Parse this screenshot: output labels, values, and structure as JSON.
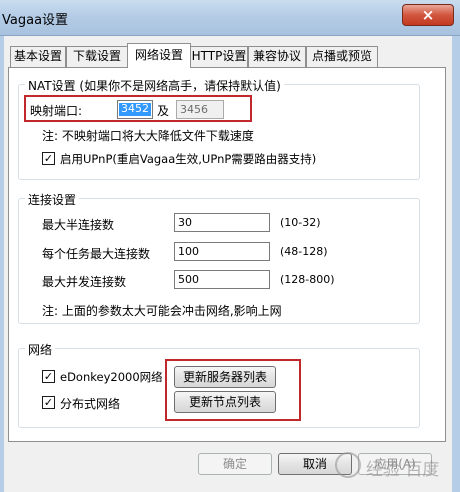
{
  "window": {
    "title": "Vagaa设置",
    "close_glyph": "×"
  },
  "tabs": [
    {
      "label": "基本设置",
      "active": false
    },
    {
      "label": "下载设置",
      "active": false
    },
    {
      "label": "网络设置",
      "active": true
    },
    {
      "label": "HTTP设置",
      "active": false
    },
    {
      "label": "兼容协议",
      "active": false
    },
    {
      "label": "点播或预览",
      "active": false
    }
  ],
  "nat": {
    "legend": "NAT设置 (如果你不是网络高手，请保持默认值)",
    "port_label": "映射端口:",
    "port_value": "3452",
    "and_label": "及",
    "port2_value": "3456",
    "note": "注: 不映射端口将大大降低文件下载速度",
    "upnp_label": "启用UPnP(重启Vagaa生效,UPnP需要路由器支持)",
    "upnp_checked": true
  },
  "connection": {
    "legend": "连接设置",
    "rows": [
      {
        "label": "最大半连接数",
        "value": "30",
        "range": "(10-32)"
      },
      {
        "label": "每个任务最大连接数",
        "value": "100",
        "range": "(48-128)"
      },
      {
        "label": "最大并发连接数",
        "value": "500",
        "range": "(128-800)"
      }
    ],
    "note": "注: 上面的参数太大可能会冲击网络,影响上网"
  },
  "network": {
    "legend": "网络",
    "edonkey_label": "eDonkey2000网络",
    "edonkey_checked": true,
    "distributed_label": "分布式网络",
    "distributed_checked": true,
    "update_servers_button": "更新服务器列表",
    "update_nodes_button": "更新节点列表"
  },
  "footer": {
    "ok_button": "确定",
    "cancel_button": "取消",
    "apply_button": "应用(A)"
  },
  "watermark": {
    "text": "经验·百度"
  },
  "colors": {
    "annotation": "#c0282c",
    "titlebar": "#b5cde6",
    "selection": "#3399ff"
  }
}
